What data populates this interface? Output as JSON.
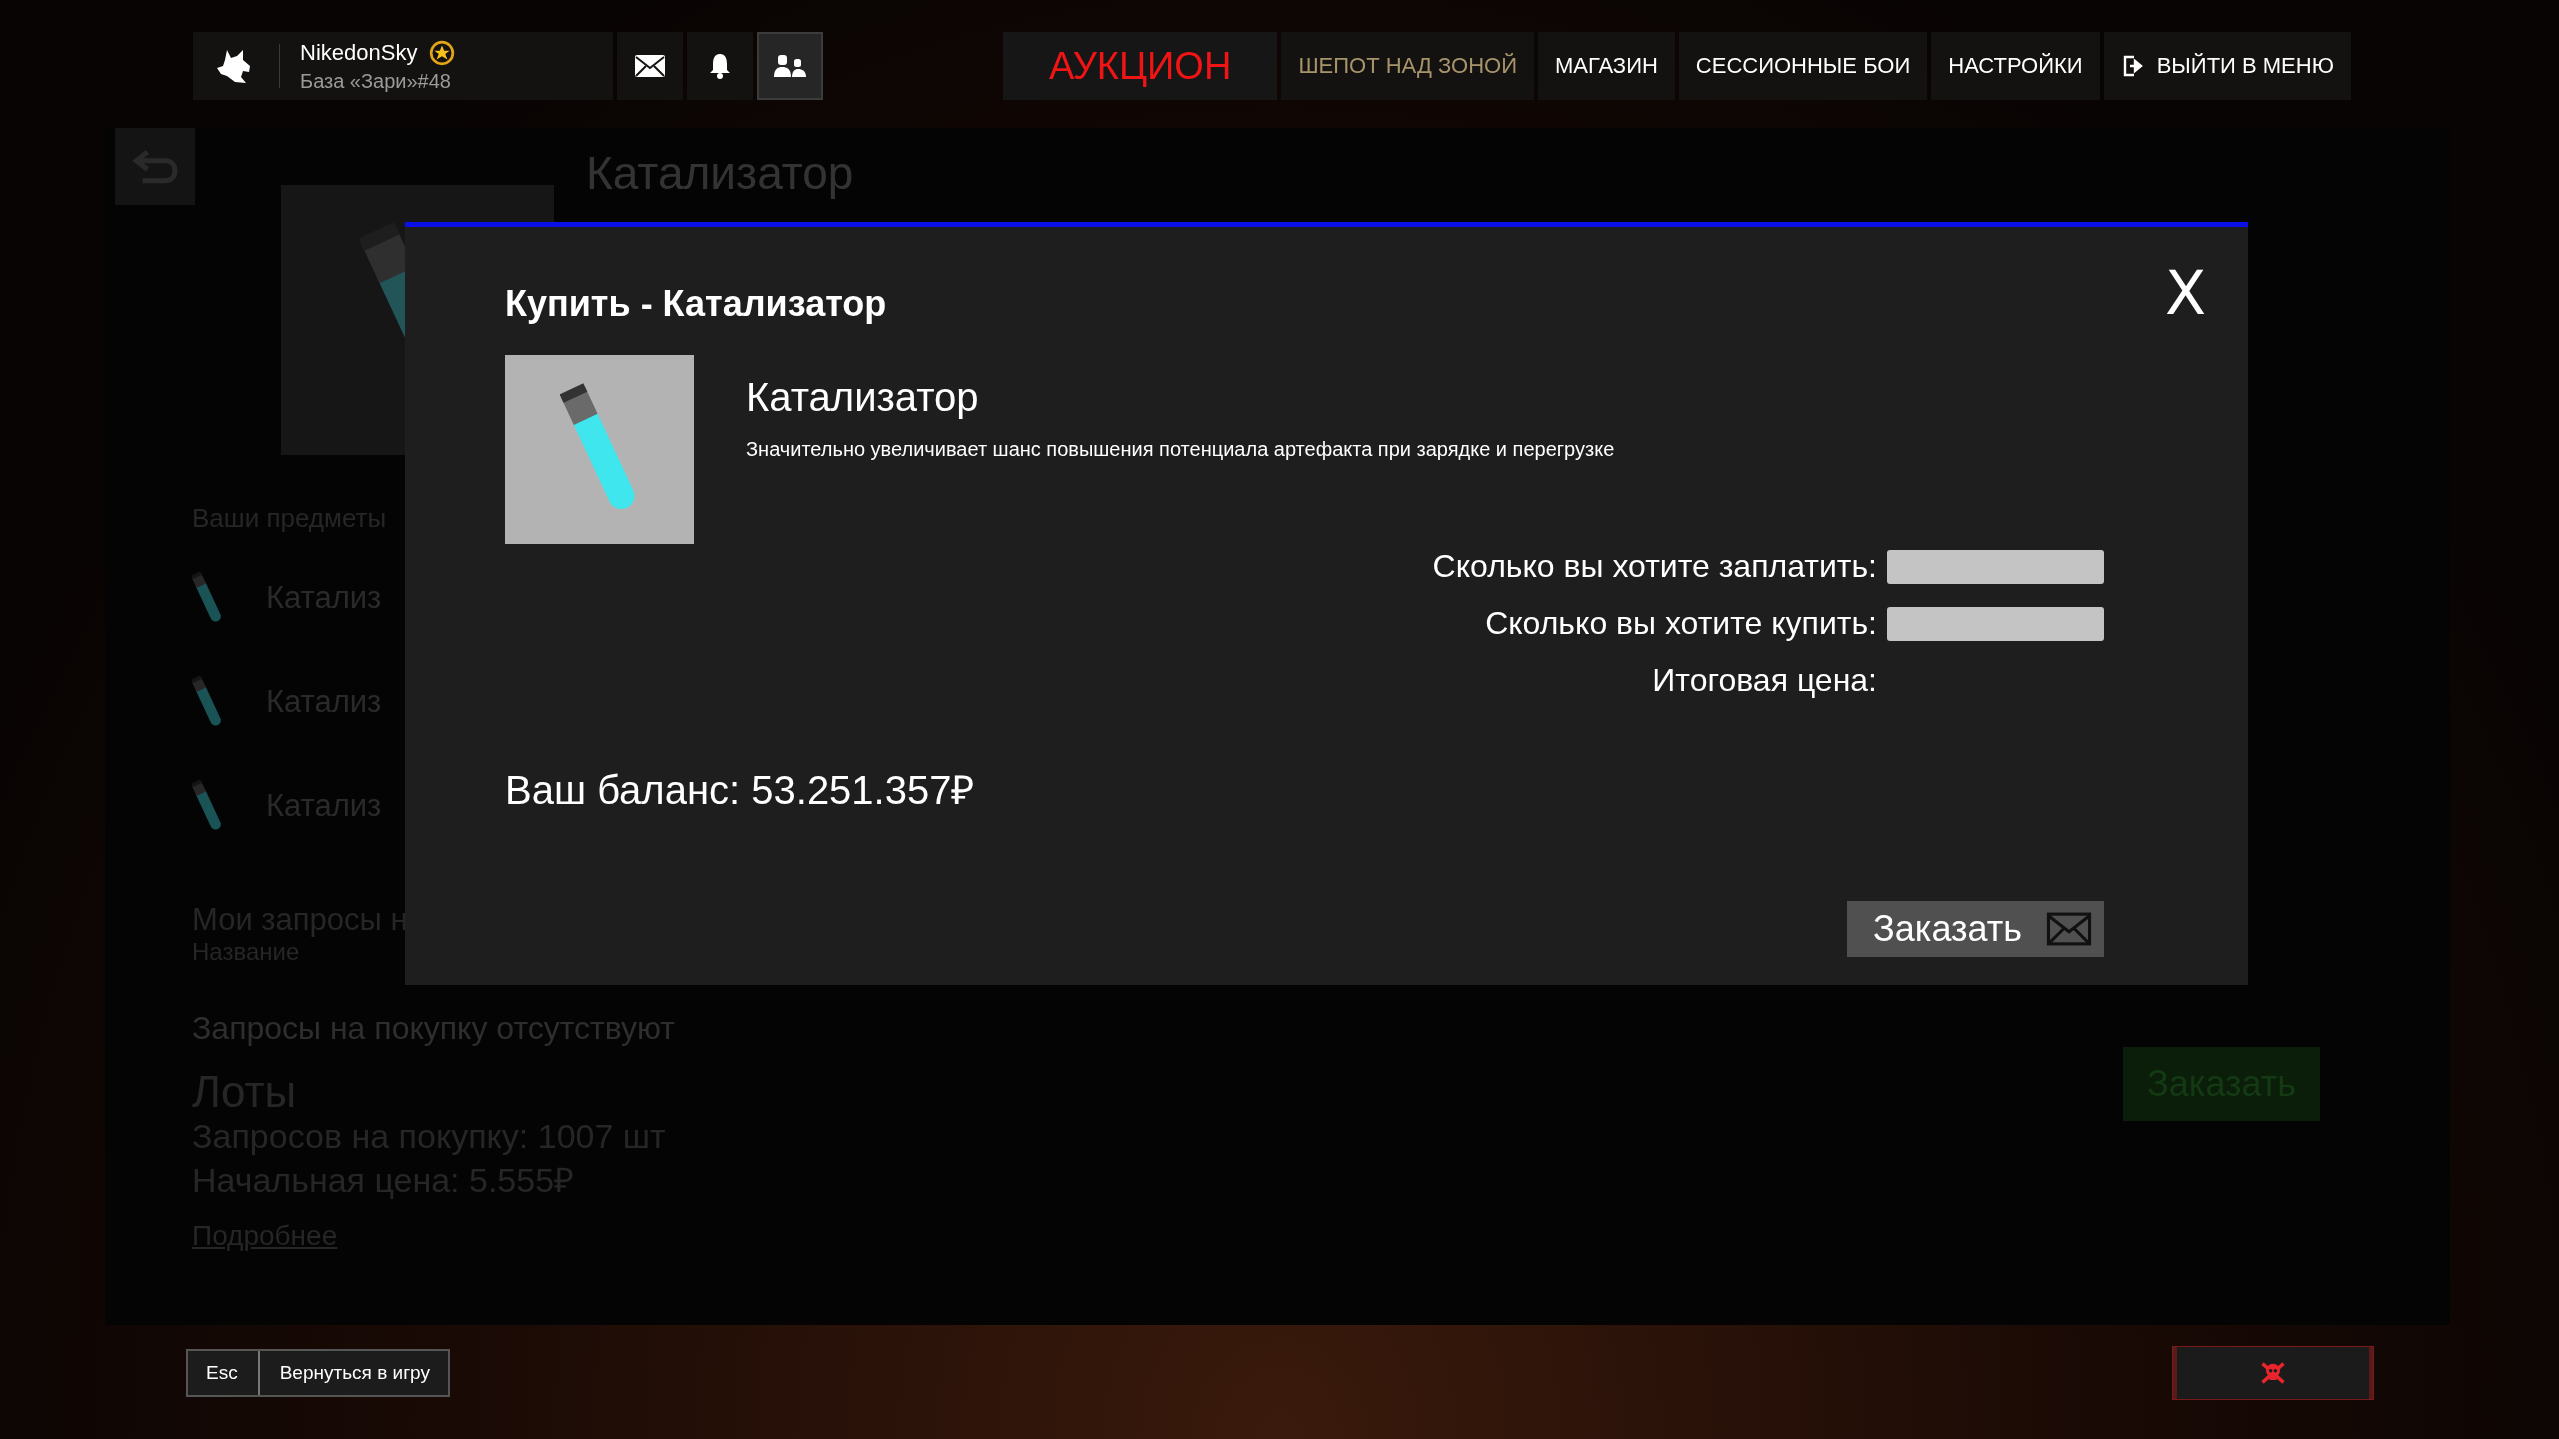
{
  "header": {
    "username": "NikedonSky",
    "base": "База «Зари»#48",
    "icon_buttons": [
      {
        "kind": "mail",
        "selected": false
      },
      {
        "kind": "bell",
        "selected": false
      },
      {
        "kind": "friends",
        "selected": true
      }
    ]
  },
  "nav": [
    {
      "label": "АУКЦИОН",
      "kind": "main",
      "selected": true
    },
    {
      "label": "ШЕПОТ НАД ЗОНОЙ",
      "kind": "event",
      "selected": false
    },
    {
      "label": "МАГАЗИН",
      "kind": "tab",
      "selected": false
    },
    {
      "label": "СЕССИОННЫЕ БОИ",
      "kind": "tab",
      "selected": false
    },
    {
      "label": "НАСТРОЙКИ",
      "kind": "tab",
      "selected": false
    },
    {
      "label": "ВЫЙТИ В МЕНЮ",
      "kind": "exit",
      "selected": false
    }
  ],
  "background_page": {
    "title": "Катализатор",
    "my_items_heading": "Ваши предметы",
    "my_items": [
      "Катализ",
      "Катализ",
      "Катализ"
    ],
    "requests_heading": "Мои запросы н",
    "column_1": "Название",
    "empty_message": "Запросы на покупку отсутствуют",
    "lots_heading": "Лоты",
    "requests_count": "Запросов на покупку: 1007 шт",
    "start_price": "Начальная цена: 5.555₽",
    "details_link": "Подробнее",
    "order_button": "Заказать"
  },
  "dialog": {
    "title": "Купить - Катализатор",
    "close": "X",
    "item_name": "Катализатор",
    "item_description": "Значительно увеличивает шанс повышения потенциала артефакта при зарядке и перегрузке",
    "fields": [
      {
        "label": "Сколько вы хотите заплатить:",
        "kind": "input"
      },
      {
        "label": "Сколько вы хотите купить:",
        "kind": "input"
      },
      {
        "label": "Итоговая цена:",
        "kind": "text"
      }
    ],
    "balance": "Ваш баланс: 53.251.357₽",
    "order_button": "Заказать"
  },
  "footer": {
    "key": "Esc",
    "action": "Вернуться в игру"
  }
}
